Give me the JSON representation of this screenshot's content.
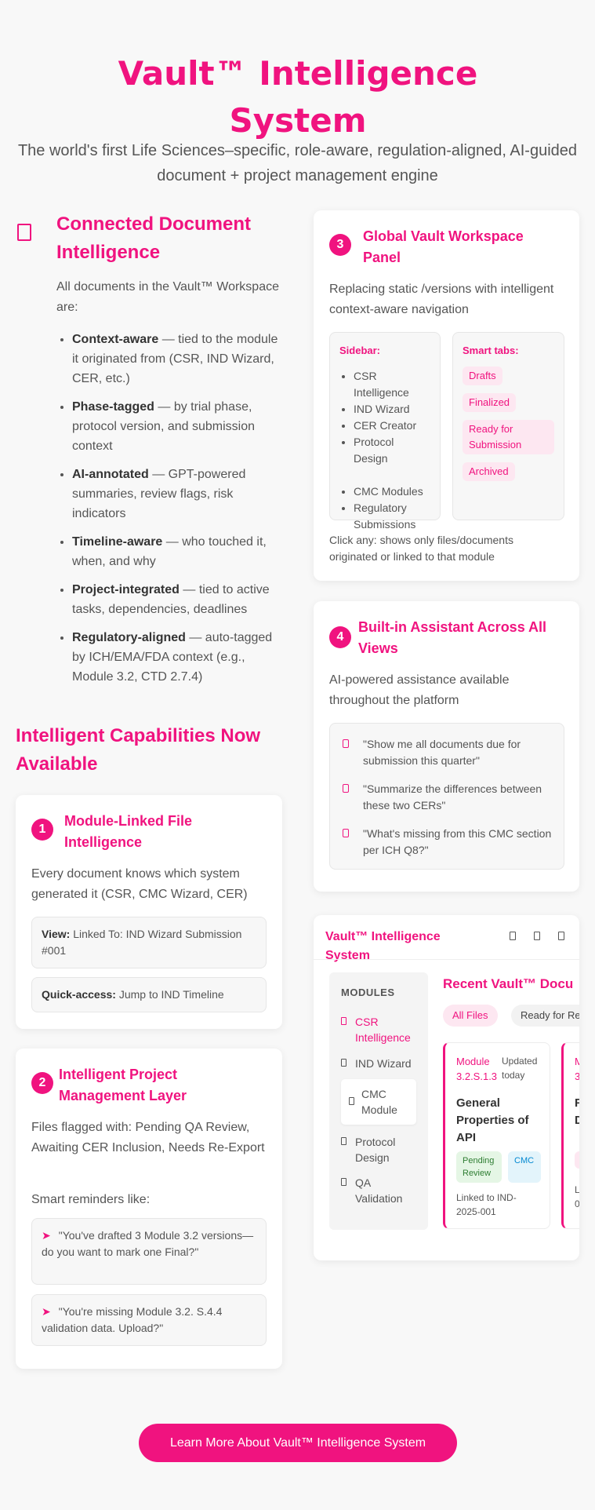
{
  "hero": {
    "title": "Vault™ Intelligence System",
    "subtitle": "The world's first Life Sciences–specific, role-aware, regulation-aligned, AI-guided document + project management engine"
  },
  "connected_doc": {
    "icon": "document-icon",
    "title": "Connected Document Intelligence",
    "intro": "All documents in the Vault™ Workspace are:",
    "items": [
      {
        "bold": "Context-aware",
        "text": " — tied to the module it originated from (CSR, IND Wizard, CER, etc.)"
      },
      {
        "bold": "Phase-tagged",
        "text": " — by trial phase, protocol version, and submission context"
      },
      {
        "bold": "AI-annotated",
        "text": " — GPT-powered summaries, review flags, risk indicators"
      },
      {
        "bold": "Timeline-aware",
        "text": " — who touched it, when, and why"
      },
      {
        "bold": "Project-integrated",
        "text": " — tied to active tasks, dependencies, deadlines"
      },
      {
        "bold": "Regulatory-aligned",
        "text": " — auto-tagged by ICH/EMA/FDA context (e.g., Module 3.2, CTD 2.7.4)"
      }
    ]
  },
  "capabilities_heading": "Intelligent Capabilities Now Available",
  "card1": {
    "num": "1",
    "title": "Module-Linked File Intelligence",
    "text": "Every document knows which system generated it (CSR, CMC Wizard, CER)",
    "view_label": "View:",
    "view_text": " Linked To: IND Wizard Submission #001",
    "quick_label": "Quick-access:",
    "quick_text": " Jump to IND Timeline"
  },
  "card2": {
    "num": "2",
    "title": "Intelligent Project Management Layer",
    "text": "Files flagged with: Pending QA Review, Awaiting CER Inclusion, Needs Re-Export",
    "reminders_label": "Smart reminders like:",
    "reminder1": "\"You've drafted 3 Module 3.2 versions—do you want to mark one Final?\"",
    "reminder2": "\"You're missing Module 3.2. S.4.4 validation data. Upload?\""
  },
  "card3": {
    "num": "3",
    "title": "Global Vault Workspace Panel",
    "text": "Replacing static /versions with intelligent context-aware navigation",
    "sidebar_label": "Sidebar:",
    "sidebar_items": [
      "CSR Intelligence",
      "IND Wizard",
      "CER Creator",
      "Protocol Design",
      "CMC Modules",
      "Regulatory Submissions"
    ],
    "tabs_label": "Smart tabs:",
    "tabs": [
      "Drafts",
      "Finalized",
      "Ready for Submission",
      "Archived"
    ],
    "footer": "Click any: shows only files/documents originated or linked to that module"
  },
  "card4": {
    "num": "4",
    "title": "Built-in Assistant Across All Views",
    "text": "AI-powered assistance available throughout the platform",
    "quotes": [
      "\"Show me all documents due for submission this quarter\"",
      "\"Summarize the differences between these two CERs\"",
      "\"What's missing from this CMC section per ICH Q8?\""
    ]
  },
  "preview": {
    "title": "Vault™ Intelligence System",
    "modules_label": "MODULES",
    "modules": [
      "CSR Intelligence",
      "IND Wizard",
      "CMC Module",
      "Protocol Design",
      "QA Validation"
    ],
    "recent_title": "Recent Vault™ Docu",
    "filter_all": "All Files",
    "filter_ready": "Ready for Revi",
    "doc1": {
      "module": "Module 3.2.S.1.3",
      "updated": "Updated today",
      "title": "General Properties of API",
      "badge_pending": "Pending Review",
      "badge_cmc": "CMC",
      "link": "Linked to IND-2025-001"
    },
    "doc2": {
      "module_frag": "M 3",
      "title_frag": "F D",
      "link_frag": "L 0"
    }
  },
  "cta": "Learn More About Vault™ Intelligence System",
  "colors": {
    "accent": "#f0137f",
    "background": "#f8f8f8"
  }
}
